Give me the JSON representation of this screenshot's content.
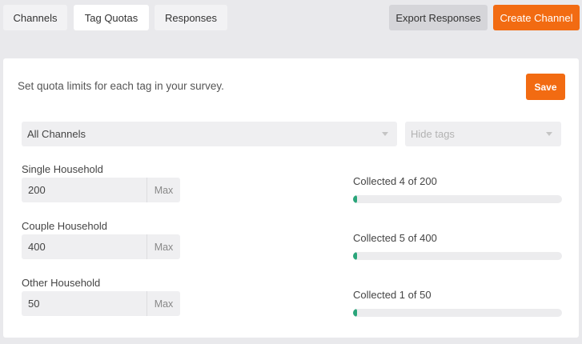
{
  "tabs": [
    {
      "label": "Channels",
      "active": false
    },
    {
      "label": "Tag Quotas",
      "active": true
    },
    {
      "label": "Responses",
      "active": false
    }
  ],
  "actions": {
    "export_label": "Export Responses",
    "create_label": "Create Channel"
  },
  "panel": {
    "description": "Set quota limits for each tag in your survey.",
    "save_label": "Save",
    "channel_select": {
      "value": "All Channels"
    },
    "tags_select": {
      "placeholder": "Hide tags"
    }
  },
  "quotas": [
    {
      "label": "Single Household",
      "value": "200",
      "addon": "Max",
      "collected_text": "Collected 4 of 200",
      "fraction": 0.02
    },
    {
      "label": "Couple Household",
      "value": "400",
      "addon": "Max",
      "collected_text": "Collected 5 of 400",
      "fraction": 0.0125
    },
    {
      "label": "Other Household",
      "value": "50",
      "addon": "Max",
      "collected_text": "Collected 1 of 50",
      "fraction": 0.02
    }
  ],
  "colors": {
    "accent": "#f26b12",
    "progress": "#2aa57a",
    "background": "#e9e9ec"
  }
}
